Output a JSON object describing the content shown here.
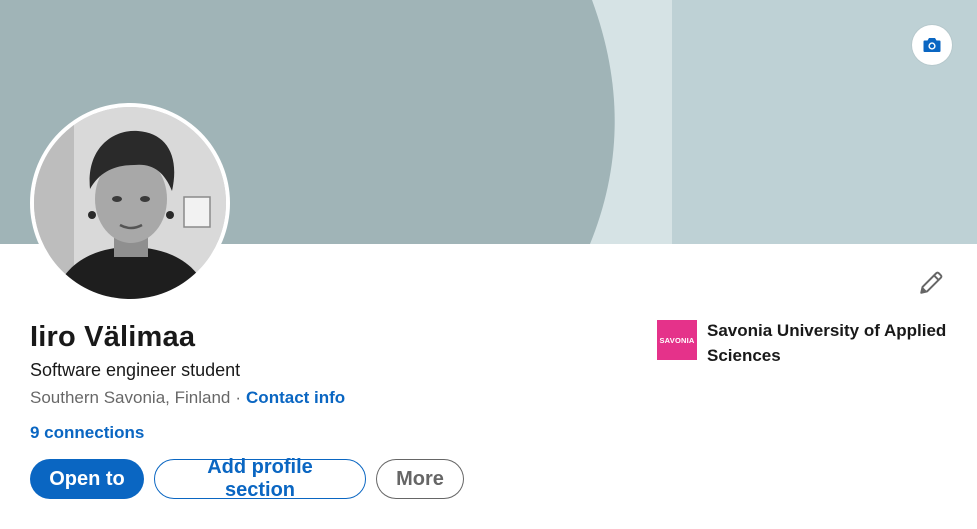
{
  "profile": {
    "name": "Iiro Välimaa",
    "headline": "Software engineer student",
    "location": "Southern Savonia, Finland",
    "separator": "·",
    "contact_info_label": "Contact info",
    "connections_label": "9 connections"
  },
  "actions": {
    "open_to_label": "Open to",
    "add_section_label": "Add profile section",
    "more_label": "More"
  },
  "education": {
    "logo_text": "SAVONIA",
    "school_name": "Savonia University of Applied Sciences"
  },
  "icons": {
    "cover_camera": "camera-icon",
    "edit": "pencil-icon"
  },
  "colors": {
    "link_blue": "#0a66c2",
    "cover_dark": "#a0b4b7",
    "cover_light": "#d6e3e5",
    "cover_mid": "#bed1d5",
    "school_logo": "#e5328a"
  }
}
